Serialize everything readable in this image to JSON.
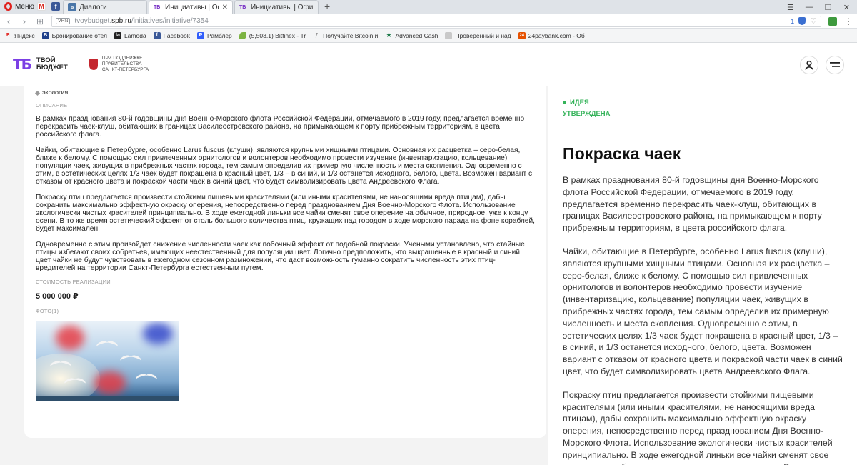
{
  "browser": {
    "menu_label": "Меню",
    "tabs": [
      {
        "label": "Диалоги",
        "active": false
      },
      {
        "label": "Инициативы | Официаль",
        "active": true
      },
      {
        "label": "Инициативы | Официаль",
        "active": false
      }
    ],
    "new_tab": "+",
    "vpn": "VPN",
    "url_prefix": "tvoybudget.",
    "url_domain": "spb.ru",
    "url_path": "/initiatives/initiative/7354",
    "badge_count": "1",
    "bookmarks": [
      {
        "label": "Яндекс",
        "icon": "yandex-icon",
        "color": "#e0201c"
      },
      {
        "label": "Бронирование отел",
        "icon": "booking-icon",
        "color": "#1d3f8a"
      },
      {
        "label": "Lamoda",
        "icon": "lamoda-icon",
        "color": "#222222"
      },
      {
        "label": "Facebook",
        "icon": "facebook-icon",
        "color": "#3b5998"
      },
      {
        "label": "Рамблер",
        "icon": "rambler-icon",
        "color": "#315efb"
      },
      {
        "label": "(5,503.1) Bitfinex - Tr",
        "icon": "bitfinex-icon",
        "color": "#7cb342"
      },
      {
        "label": "Получайте Bitcoin и",
        "icon": "bitcoin-icon",
        "color": "#777777"
      },
      {
        "label": "Advanced Cash",
        "icon": "star-icon",
        "color": "#1d7a4a"
      },
      {
        "label": "Проверенный и над",
        "icon": "folder-icon",
        "color": "#888888"
      },
      {
        "label": "24paybank.com - Об",
        "icon": "24paybank-icon",
        "color": "#e65100"
      }
    ]
  },
  "header": {
    "logo_mark": "ТБ",
    "logo_line1": "ТВОЙ",
    "logo_line2": "БЮДЖЕТ",
    "gov_line1": "ПРИ ПОДДЕРЖКЕ",
    "gov_line2": "ПРАВИТЕЛЬСТВА",
    "gov_line3": "САНКТ-ПЕТЕРБУРГА"
  },
  "card": {
    "category": "ЭКОЛОГИЯ",
    "description_label": "ОПИСАНИЕ",
    "paragraphs": [
      "В рамках празднования 80-й годовщины дня Военно-Морского флота Российской Федерации, отмечаемого в 2019 году, предлагается временно перекрасить чаек-клуш, обитающих в границах  Василеостровского района, на примыкающем к порту прибрежным территориям, в цвета российского флага.",
      "Чайки, обитающие в Петербурге, особенно Larus fuscus (клуши), являются крупными хищными птицами. Основная их расцветка – серо-белая, ближе к белому. С помощью сил привлеченных орнитологов и волонтеров необходимо провести изучение (инвентаризацию, кольцевание) популяции чаек, живущих в прибрежных частях города, тем самым определив их примерную численность и места скопления. Одновременно с этим, в эстетических целях 1/3 чаек будет покрашена в красный цвет, 1/3 – в синий, и 1/3 останется исходного, белого, цвета. Возможен вариант с отказом от красного цвета и покраской части чаек в синий цвет, что будет символизировать цвета Андреевского Флага.",
      "Покраску птиц предлагается произвести стойкими пищевыми красителями (или иными красителями, не наносящими вреда птицам), дабы сохранить максимально эффектную окраску оперения, непосредственно перед празднованием Дня Военно-Морского Флота. Использование экологически чистых красителей принципиально. В ходе ежегодной линьки все чайки сменят свое оперение на обычное, природное, уже к концу осени. В то же время эстетический эффект от столь большого количества птиц, кружащих над городом в ходе морского парада на фоне кораблей, будет максимален.",
      "Одновременно с этим произойдет снижение численности чаек как побочный эффект от подобной покраски. Учеными установлено, что стайные птицы избегают своих собратьев, имеющих неестественный для популяции цвет. Логично предположить, что выкрашенные в красный и синий цвет чайки не будут чувствовать в ежегодном сезонном размножении, что даст возможность гуманно сократить численность этих птиц-вредителей на территории Санкт-Петербурга естественным путем."
    ],
    "cost_label": "СТОИМОСТЬ РЕАЛИЗАЦИИ",
    "cost_value": "5 000 000 ₽",
    "photo_label": "ФОТО(1)"
  },
  "side": {
    "status1": "ИДЕЯ",
    "status2": "УТВЕРЖДЕНА",
    "status_color": "#35b35a",
    "title": "Покраска чаек",
    "paragraphs": [
      "В рамках празднования 80-й годовщины дня Военно-Морского флота Российской Федерации, отмечаемого в 2019 году, предлагается временно перекрасить чаек-клуш, обитающих в границах Василеостровского района, на примыкающем к порту прибрежным территориям, в цвета российского флага.",
      "Чайки, обитающие в Петербурге, особенно Larus fuscus (клуши), являются крупными хищными птицами. Основная их расцветка – серо-белая, ближе к белому. С помощью сил привлеченных орнитологов и волонтеров необходимо провести изучение (инвентаризацию, кольцевание) популяции чаек, живущих в прибрежных частях города, тем самым определив их примерную численность и места скопления. Одновременно с этим, в эстетических целях 1/3 чаек будет покрашена в красный цвет, 1/3 – в синий, и 1/3 останется исходного, белого, цвета. Возможен вариант с отказом от красного цвета и покраской части чаек в синий цвет, что будет символизировать цвета Андреевского Флага.",
      "Покраску птиц предлагается произвести стойкими пищевыми красителями (или иными красителями, не наносящими вреда птицам), дабы сохранить максимально эффектную окраску оперения, непосредственно перед празднованием Дня Военно-Морского Флота. Использование экологически чистых красителей принципиально. В ходе ежегодной линьки все чайки сменят свое оперение на обычное, природное, уже к концу осени. В то же время"
    ]
  },
  "colors": {
    "brand": "#7b3fe4",
    "accent_green": "#35b35a"
  }
}
